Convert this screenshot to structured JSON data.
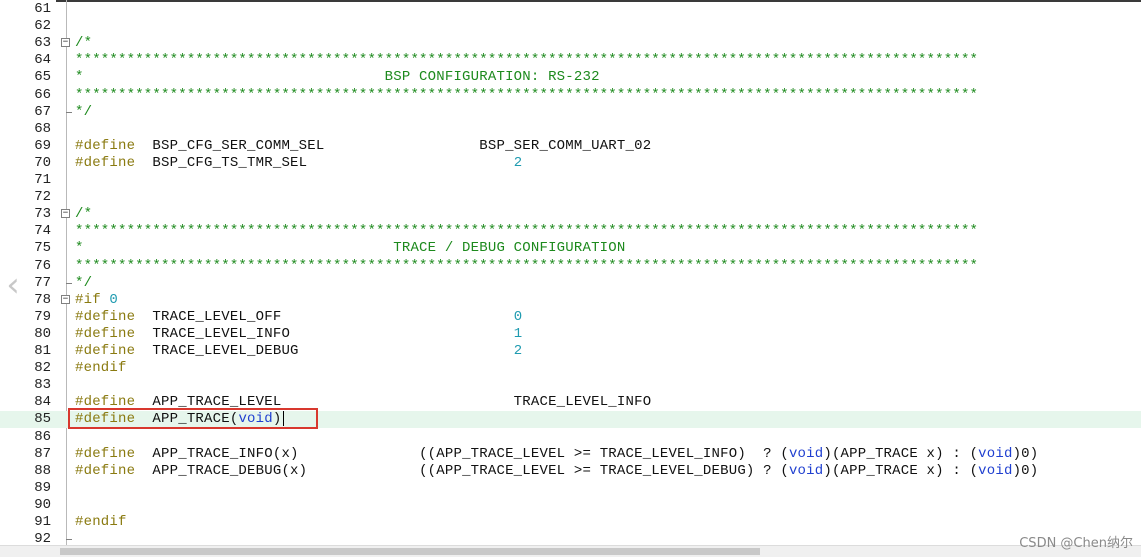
{
  "editor": {
    "lines": [
      {
        "n": "61",
        "code": ""
      },
      {
        "n": "62",
        "code": ""
      },
      {
        "n": "63",
        "code": "/*",
        "fold": "start",
        "type": "comment"
      },
      {
        "n": "64",
        "code": "*********************************************************************************************************",
        "type": "comment"
      },
      {
        "n": "65",
        "code": "*                                   BSP CONFIGURATION: RS-232",
        "type": "comment"
      },
      {
        "n": "66",
        "code": "*********************************************************************************************************",
        "type": "comment"
      },
      {
        "n": "67",
        "code": "*/",
        "type": "comment",
        "fold": "end"
      },
      {
        "n": "68",
        "code": ""
      },
      {
        "n": "69",
        "code": "BSP_CFG_SER_COMM_SEL                  BSP_SER_COMM_UART_02",
        "directive": "#define"
      },
      {
        "n": "70",
        "code": "BSP_CFG_TS_TMR_SEL                        ",
        "directive": "#define",
        "value": "2"
      },
      {
        "n": "71",
        "code": ""
      },
      {
        "n": "72",
        "code": ""
      },
      {
        "n": "73",
        "code": "/*",
        "fold": "start",
        "type": "comment"
      },
      {
        "n": "74",
        "code": "*********************************************************************************************************",
        "type": "comment"
      },
      {
        "n": "75",
        "code": "*                                    TRACE / DEBUG CONFIGURATION",
        "type": "comment"
      },
      {
        "n": "76",
        "code": "*********************************************************************************************************",
        "type": "comment"
      },
      {
        "n": "77",
        "code": "*/",
        "type": "comment",
        "fold": "end"
      },
      {
        "n": "78",
        "code": "",
        "directive": "#if",
        "value": "0",
        "fold": "start"
      },
      {
        "n": "79",
        "code": "TRACE_LEVEL_OFF                           ",
        "directive": "#define",
        "value": "0"
      },
      {
        "n": "80",
        "code": "TRACE_LEVEL_INFO                          ",
        "directive": "#define",
        "value": "1"
      },
      {
        "n": "81",
        "code": "TRACE_LEVEL_DEBUG                         ",
        "directive": "#define",
        "value": "2"
      },
      {
        "n": "82",
        "code": "",
        "directive": "#endif"
      },
      {
        "n": "83",
        "code": ""
      },
      {
        "n": "84",
        "code": "APP_TRACE_LEVEL                           TRACE_LEVEL_INFO",
        "directive": "#define"
      },
      {
        "n": "85",
        "code": "APP_TRACE(void)",
        "directive": "#define",
        "current": true
      },
      {
        "n": "86",
        "code": ""
      },
      {
        "n": "87",
        "code": "APP_TRACE_INFO(x)              ((APP_TRACE_LEVEL >= TRACE_LEVEL_INFO)  ? (void)(APP_TRACE x) : (void)0)",
        "directive": "#define"
      },
      {
        "n": "88",
        "code": "APP_TRACE_DEBUG(x)             ((APP_TRACE_LEVEL >= TRACE_LEVEL_DEBUG) ? (void)(APP_TRACE x) : (void)0)",
        "directive": "#define"
      },
      {
        "n": "89",
        "code": ""
      },
      {
        "n": "90",
        "code": ""
      },
      {
        "n": "91",
        "code": "",
        "directive": "#endif"
      },
      {
        "n": "92",
        "code": "",
        "fold": "end"
      }
    ]
  },
  "nav": {
    "back_icon": "chevron-left-icon",
    "back_glyph": "‹"
  },
  "watermark": "CSDN @Chen纳尔",
  "colors": {
    "comment": "#1d8a1d",
    "directive": "#8a7a10",
    "number": "#1f9bb0",
    "keyword": "#1f3fd0",
    "highlight": "#d8382e"
  }
}
